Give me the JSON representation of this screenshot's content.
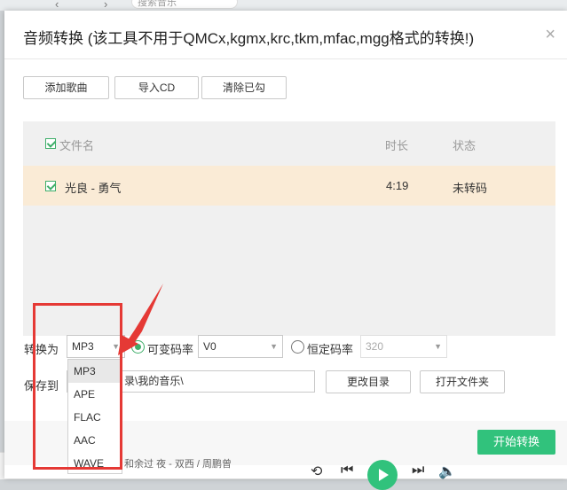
{
  "background": {
    "search_placeholder": "搜索音乐",
    "now_playing_title": "和余过",
    "now_playing_artist": "夜 - 双西 / 周鹏曾"
  },
  "dialog": {
    "title": "音频转换 (该工具不用于QMCx,kgmx,krc,tkm,mfac,mgg格式的转换!)",
    "close_label": "×"
  },
  "toolbar": {
    "add_song": "添加歌曲",
    "import_cd": "导入CD",
    "clear_checked": "清除已勾"
  },
  "table": {
    "columns": {
      "filename": "文件名",
      "duration": "时长",
      "status": "状态"
    },
    "rows": [
      {
        "checked": true,
        "filename": "光良 - 勇气",
        "duration": "4:19",
        "status": "未转码"
      }
    ]
  },
  "convert": {
    "label": "转换为",
    "format_value": "MP3",
    "vbr_label": "可变码率",
    "vbr_value": "V0",
    "cbr_label": "恒定码率",
    "cbr_value": "320",
    "format_options": [
      "MP3",
      "APE",
      "FLAC",
      "AAC",
      "WAVE"
    ]
  },
  "save": {
    "label": "保存到",
    "path": "录\\我的音乐\\",
    "change_dir": "更改目录",
    "open_folder": "打开文件夹"
  },
  "start_convert": "开始转换",
  "colors": {
    "accent": "#31c27c",
    "highlight": "#e53935",
    "row": "#faebd6"
  }
}
